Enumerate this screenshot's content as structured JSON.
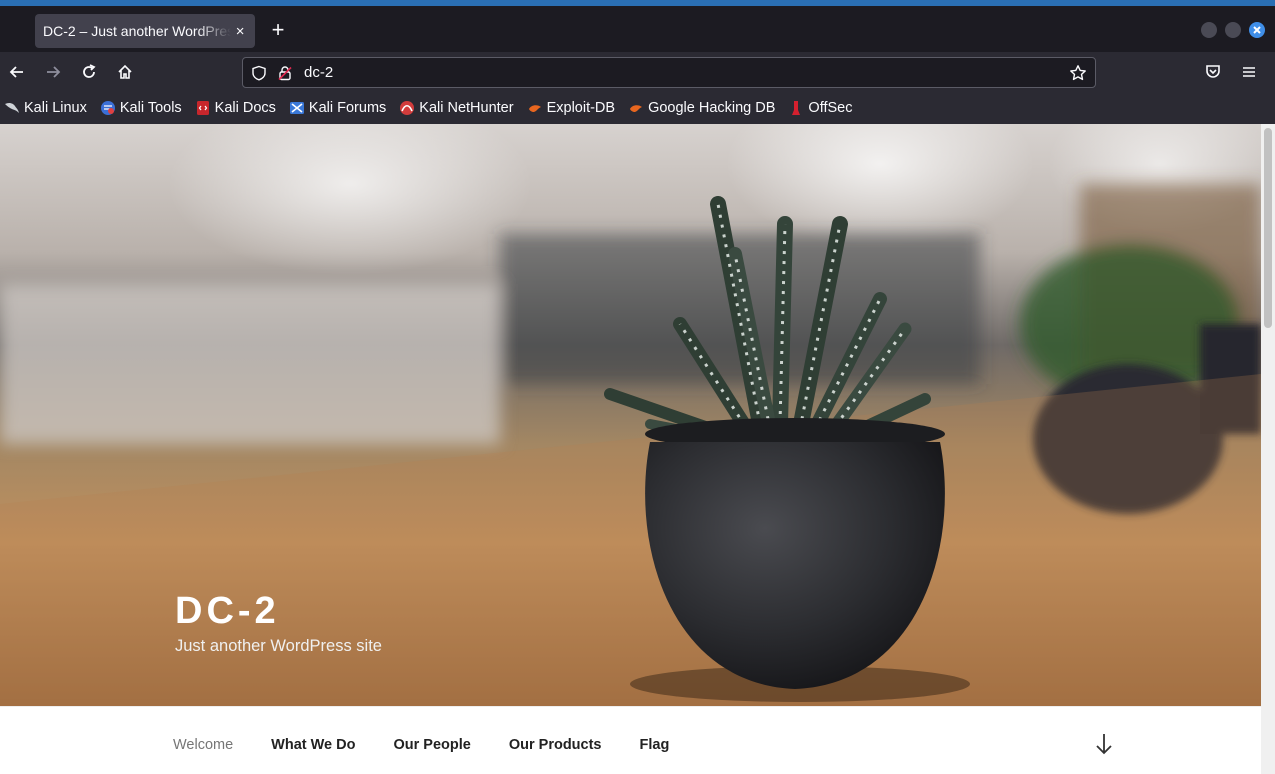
{
  "browser": {
    "tab": {
      "title": "DC-2 – Just another WordPress site",
      "close_glyph": "×"
    },
    "new_tab_glyph": "+",
    "address": {
      "url": "dc-2"
    },
    "bookmarks": [
      {
        "label": "Kali Linux",
        "icon": "kali-dragon-icon"
      },
      {
        "label": "Kali Tools",
        "icon": "kali-tools-icon"
      },
      {
        "label": "Kali Docs",
        "icon": "kali-docs-icon"
      },
      {
        "label": "Kali Forums",
        "icon": "kali-forums-icon"
      },
      {
        "label": "Kali NetHunter",
        "icon": "nethunter-icon"
      },
      {
        "label": "Exploit-DB",
        "icon": "exploit-db-icon"
      },
      {
        "label": "Google Hacking DB",
        "icon": "ghdb-icon"
      },
      {
        "label": "OffSec",
        "icon": "offsec-icon"
      }
    ]
  },
  "site": {
    "title": "DC-2",
    "tagline": "Just another WordPress site",
    "menu": [
      {
        "label": "Welcome",
        "current": true
      },
      {
        "label": "What We Do"
      },
      {
        "label": "Our People"
      },
      {
        "label": "Our Products"
      },
      {
        "label": "Flag"
      }
    ]
  },
  "colors": {
    "accent": "#2a6fb4",
    "toolbar": "#2b2a33",
    "tabbar": "#1c1b22"
  }
}
